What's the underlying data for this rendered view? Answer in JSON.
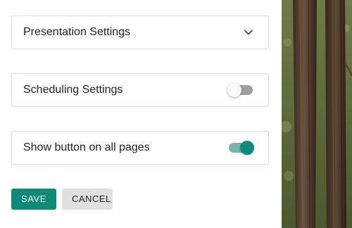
{
  "settings": {
    "presentation": {
      "label": "Presentation Settings",
      "expanded": false,
      "icon": "chevron-down-icon"
    },
    "scheduling": {
      "label": "Scheduling Settings",
      "enabled": false
    },
    "show_button": {
      "label": "Show button on all pages",
      "enabled": true
    }
  },
  "actions": {
    "save_label": "SAVE",
    "cancel_label": "CANCEL"
  },
  "colors": {
    "accent": "#0e8a78",
    "accent_track": "#73b8ad",
    "toggle_off_track": "#9e9e9e",
    "cancel_bg": "#e0e0e0",
    "border": "#dcdcdc"
  },
  "background_image": "forest-tree-trunks"
}
